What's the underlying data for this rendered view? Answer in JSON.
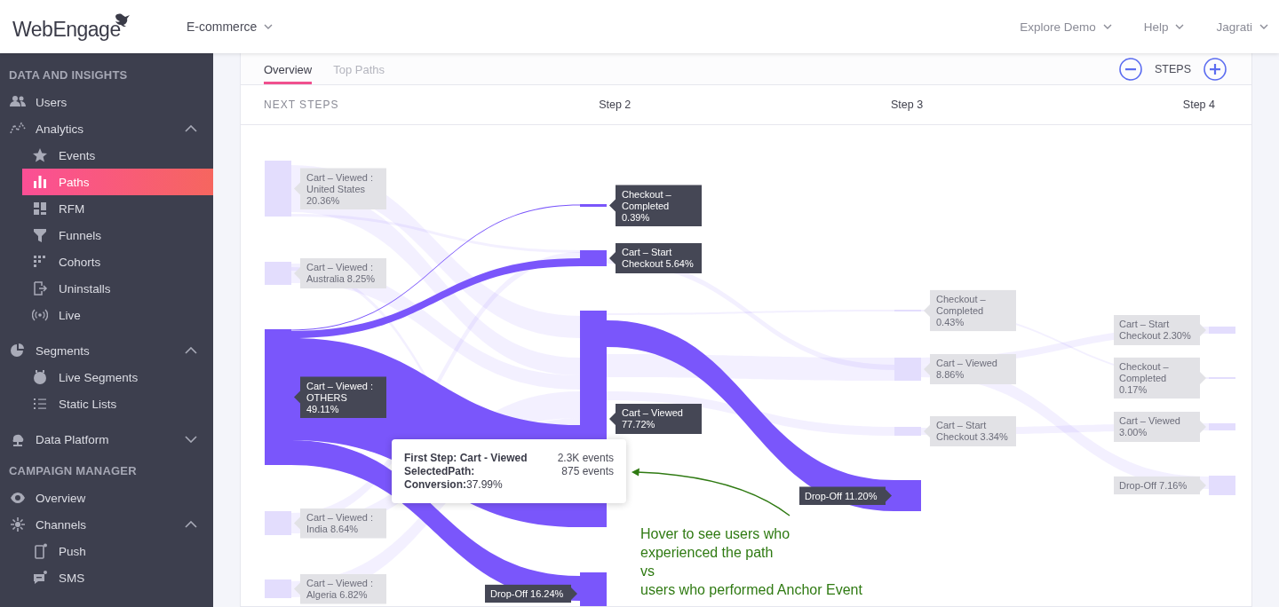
{
  "header": {
    "logo": "WebEngage",
    "project": "E-commerce",
    "menus": [
      "Explore Demo",
      "Help",
      "Jagrati"
    ]
  },
  "sidebar": {
    "sections": [
      {
        "title": "DATA AND INSIGHTS",
        "items": [
          {
            "label": "Users",
            "selected": false
          },
          {
            "label": "Analytics",
            "selected": false,
            "expanded": true,
            "children": [
              {
                "label": "Events",
                "selected": false
              },
              {
                "label": "Paths",
                "selected": true
              },
              {
                "label": "RFM",
                "selected": false
              },
              {
                "label": "Funnels",
                "selected": false
              },
              {
                "label": "Cohorts",
                "selected": false
              },
              {
                "label": "Uninstalls",
                "selected": false
              },
              {
                "label": "Live",
                "selected": false
              }
            ]
          },
          {
            "label": "Segments",
            "selected": false,
            "expanded": true,
            "children": [
              {
                "label": "Live Segments",
                "selected": false
              },
              {
                "label": "Static Lists",
                "selected": false
              }
            ]
          },
          {
            "label": "Data Platform",
            "selected": false,
            "expanded": false
          }
        ]
      },
      {
        "title": "CAMPAIGN MANAGER",
        "items": [
          {
            "label": "Overview",
            "selected": false
          },
          {
            "label": "Channels",
            "selected": false,
            "expanded": true,
            "children": [
              {
                "label": "Push",
                "selected": false
              },
              {
                "label": "SMS",
                "selected": false
              }
            ]
          }
        ]
      }
    ]
  },
  "tabs": [
    {
      "label": "Overview",
      "selected": true
    },
    {
      "label": "Top Paths",
      "selected": false
    }
  ],
  "steps_control": {
    "label": "STEPS"
  },
  "columns": [
    "NEXT STEPS",
    "Step 2",
    "Step 3",
    "Step 4"
  ],
  "steps": [
    {
      "nodes": [
        {
          "label": "Cart – Viewed : United States 20.36%",
          "kind": "event",
          "highlighted": false
        },
        {
          "label": "Cart – Viewed : Australia 8.25%",
          "kind": "event",
          "highlighted": false
        },
        {
          "label": "Cart – Viewed : OTHERS 49.11%",
          "kind": "event",
          "highlighted": true
        },
        {
          "label": "Cart – Viewed : India 8.64%",
          "kind": "event",
          "highlighted": false
        },
        {
          "label": "Cart – Viewed : Algeria 6.82%",
          "kind": "event",
          "highlighted": false
        }
      ]
    },
    {
      "nodes": [
        {
          "label": "Checkout – Completed 0.39%",
          "kind": "event",
          "highlighted": true
        },
        {
          "label": "Cart – Start Checkout 5.64%",
          "kind": "event",
          "highlighted": true
        },
        {
          "label": "Cart – Viewed 77.72%",
          "kind": "event",
          "highlighted": true
        },
        {
          "label": "Drop-Off 16.24%",
          "kind": "drop_off",
          "highlighted": true
        }
      ]
    },
    {
      "nodes": [
        {
          "label": "Checkout – Completed 0.43%",
          "kind": "event",
          "highlighted": false
        },
        {
          "label": "Cart – Viewed 8.86%",
          "kind": "event",
          "highlighted": false
        },
        {
          "label": "Cart – Start Checkout 3.34%",
          "kind": "event",
          "highlighted": false
        },
        {
          "label": "Drop-Off 11.20%",
          "kind": "drop_off",
          "highlighted": true
        }
      ]
    },
    {
      "nodes": [
        {
          "label": "Cart – Start Checkout 2.30%",
          "kind": "event",
          "highlighted": false
        },
        {
          "label": "Checkout – Completed 0.17%",
          "kind": "event",
          "highlighted": false
        },
        {
          "label": "Cart – Viewed 3.00%",
          "kind": "event",
          "highlighted": false
        },
        {
          "label": "Drop-Off 7.16%",
          "kind": "drop_off",
          "highlighted": false
        }
      ]
    }
  ],
  "tooltip": {
    "rows": [
      {
        "label": "First Step: Cart - Viewed",
        "count": "2.3K events"
      },
      {
        "label": "SelectedPath:",
        "count": "875 events"
      },
      {
        "label": "Conversion:",
        "value": "37.99%"
      }
    ]
  },
  "annotation": {
    "text": "Hover to see users who\nexperienced the path\nvs\nusers who performed Anchor Event"
  }
}
